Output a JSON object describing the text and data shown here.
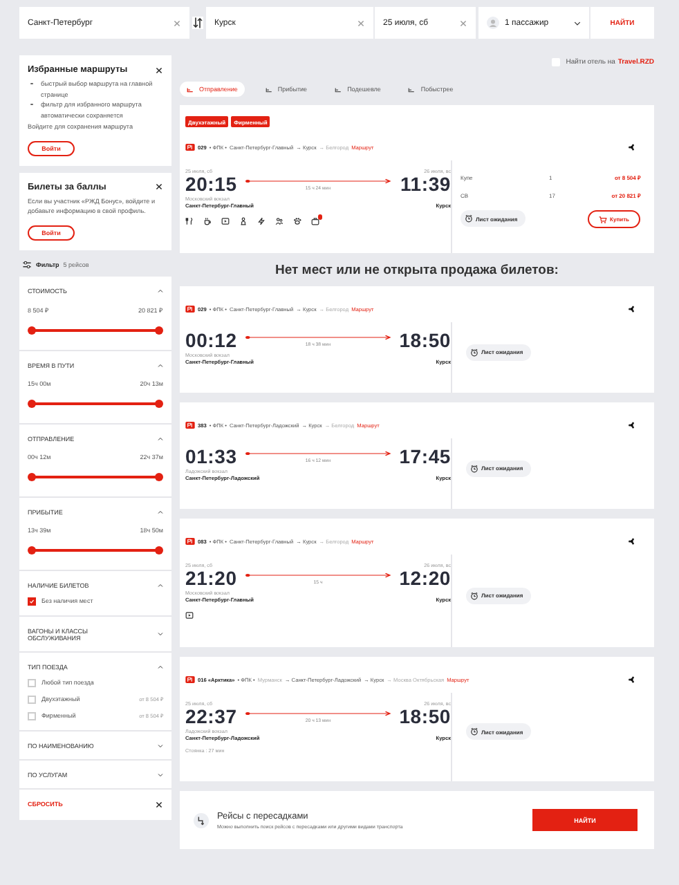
{
  "search": {
    "from": "Санкт-Петербург",
    "to": "Курск",
    "date": "25 июля, сб",
    "passengers": "1 пассажир",
    "button": "НАЙТИ"
  },
  "favorites": {
    "title": "Избранные маршруты",
    "bullets": [
      "быстрый выбор маршрута на главной странице",
      "фильтр для избранного маршрута автоматически сохраняется"
    ],
    "note": "Войдите для сохранения маршрута",
    "button": "Войти"
  },
  "bonus": {
    "title": "Билеты за баллы",
    "text": "Если вы участник «РЖД Бонус», войдите и добавьте информацию в свой профиль.",
    "button": "Войти"
  },
  "filter_header": {
    "label": "Фильтр",
    "count": "5 рейсов"
  },
  "filters": [
    {
      "kind": "range",
      "title": "СТОИМОСТЬ",
      "expanded": true,
      "min": "8 504 ₽",
      "max": "20 821 ₽",
      "level": 1
    },
    {
      "kind": "range",
      "title": "ВРЕМЯ В ПУТИ",
      "expanded": true,
      "min": "15ч 00м",
      "max": "20ч 13м",
      "level": 1
    },
    {
      "kind": "range",
      "title": "ОТПРАВЛЕНИЕ",
      "expanded": true,
      "min": "00ч 12м",
      "max": "22ч 37м",
      "level": 1
    },
    {
      "kind": "range",
      "title": "ПРИБЫТИЕ",
      "expanded": true,
      "min": "13ч 39м",
      "max": "18ч 50м",
      "level": 1
    },
    {
      "kind": "checks",
      "title": "НАЛИЧИЕ БИЛЕТОВ",
      "expanded": true,
      "options": [
        {
          "label": "Без наличия мест",
          "checked": true
        }
      ]
    },
    {
      "title": "ВАГОНЫ И КЛАССЫ ОБСЛУЖИВАНИЯ",
      "expanded": false
    },
    {
      "kind": "checks",
      "title": "ТИП ПОЕЗДА",
      "expanded": true,
      "options": [
        {
          "label": "Любой тип поезда",
          "checked": false
        },
        {
          "label": "Двухэтажный",
          "price": "от 8 504 ₽",
          "checked": false
        },
        {
          "label": "Фирменный",
          "price": "от 8 504 ₽",
          "checked": false
        }
      ]
    },
    {
      "title": "ПО НАИМЕНОВАНИЮ",
      "expanded": false
    },
    {
      "title": "ПО УСЛУГАМ",
      "expanded": false
    }
  ],
  "reset": "СБРОСИТЬ",
  "hotel": {
    "label": "Найти отель на",
    "link": "Travel.RZD",
    "checked": false
  },
  "sort_tabs": [
    {
      "label": "Отправление",
      "selected": true
    },
    {
      "label": "Прибытие",
      "selected": false
    },
    {
      "label": "Подешевле",
      "selected": false
    },
    {
      "label": "Побыстрее",
      "selected": false
    }
  ],
  "trains": [
    {
      "badges": [
        "Двухэтажный",
        "Фирменный"
      ],
      "header": [
        {
          "kind": "number",
          "text": "029"
        },
        {
          "kind": "plain",
          "text": "• ФПК •"
        },
        {
          "kind": "plain",
          "text": "Санкт-Петербург-Главный"
        },
        {
          "kind": "plain",
          "text": "→ Курск"
        },
        {
          "kind": "muted",
          "text": "→ Белгород"
        },
        {
          "kind": "link",
          "text": "Маршрут"
        }
      ],
      "depart": {
        "date": "25 июля, сб",
        "time": "20:15",
        "note": "Московский вокзал",
        "station": "Санкт-Петербург-Главный"
      },
      "arrive": {
        "date": "26 июля, вс",
        "time": "11:39",
        "station": "Курск"
      },
      "duration": "15 ч 24 мин",
      "amenities": [
        {
          "kind": "food"
        },
        {
          "kind": "cup"
        },
        {
          "kind": "video"
        },
        {
          "kind": "person"
        },
        {
          "kind": "bolt"
        },
        {
          "kind": "people"
        },
        {
          "kind": "pet"
        },
        {
          "kind": "bag",
          "badge": true
        }
      ],
      "classes": [
        {
          "name": "Купе",
          "seats": "1",
          "price": "от 8 504 ₽"
        },
        {
          "name": "СВ",
          "seats": "17",
          "price": "от 20 821 ₽"
        }
      ],
      "waitlist": "Лист ожидания",
      "buy": "Купить"
    },
    {
      "heading_before": "Нет мест или не открыта продажа билетов:",
      "header": [
        {
          "kind": "number",
          "text": "029"
        },
        {
          "kind": "plain",
          "text": "• ФПК •"
        },
        {
          "kind": "plain",
          "text": "Санкт-Петербург-Главный"
        },
        {
          "kind": "plain",
          "text": "→ Курск"
        },
        {
          "kind": "muted",
          "text": "→ Белгород"
        },
        {
          "kind": "link",
          "text": "Маршрут"
        }
      ],
      "depart": {
        "time": "00:12",
        "note": "Московский вокзал",
        "station": "Санкт-Петербург-Главный"
      },
      "arrive": {
        "time": "18:50",
        "station": "Курск"
      },
      "duration": "18 ч 38 мин",
      "waitlist": "Лист ожидания"
    },
    {
      "header": [
        {
          "kind": "number",
          "text": "383"
        },
        {
          "kind": "plain",
          "text": "• ФПК •"
        },
        {
          "kind": "plain",
          "text": "Санкт-Петербург-Ладожский"
        },
        {
          "kind": "plain",
          "text": "→ Курск"
        },
        {
          "kind": "muted",
          "text": "→ Белгород"
        },
        {
          "kind": "link",
          "text": "Маршрут"
        }
      ],
      "depart": {
        "time": "01:33",
        "note": "Ладожский вокзал",
        "station": "Санкт-Петербург-Ладожский"
      },
      "arrive": {
        "time": "17:45",
        "station": "Курск"
      },
      "duration": "16 ч 12 мин",
      "waitlist": "Лист ожидания"
    },
    {
      "header": [
        {
          "kind": "number",
          "text": "083"
        },
        {
          "kind": "plain",
          "text": "• ФПК •"
        },
        {
          "kind": "plain",
          "text": "Санкт-Петербург-Главный"
        },
        {
          "kind": "plain",
          "text": "→ Курск"
        },
        {
          "kind": "muted",
          "text": "→ Белгород"
        },
        {
          "kind": "link",
          "text": "Маршрут"
        }
      ],
      "depart": {
        "date": "25 июля, сб",
        "time": "21:20",
        "note": "Московский вокзал",
        "station": "Санкт-Петербург-Главный"
      },
      "arrive": {
        "date": "26 июля, вс",
        "time": "12:20",
        "station": "Курск"
      },
      "duration": "15 ч",
      "amenities": [
        {
          "kind": "video"
        }
      ],
      "waitlist": "Лист ожидания"
    },
    {
      "header": [
        {
          "kind": "number",
          "text": "016 «Арктика»"
        },
        {
          "kind": "plain",
          "text": "• ФПК •"
        },
        {
          "kind": "muted",
          "text": "Мурманск"
        },
        {
          "kind": "plain",
          "text": "→ Санкт-Петербург-Ладожский"
        },
        {
          "kind": "plain",
          "text": "→ Курск"
        },
        {
          "kind": "muted",
          "text": "→ Москва Октябрьская"
        },
        {
          "kind": "link",
          "text": "Маршрут"
        }
      ],
      "depart": {
        "date": "25 июля, сб",
        "time": "22:37",
        "note": "Ладожский вокзал",
        "station": "Санкт-Петербург-Ладожский"
      },
      "arrive": {
        "date": "26 июля, вс",
        "time": "18:50",
        "station": "Курск"
      },
      "duration": "20 ч 13 мин",
      "stop": "Стоянка : 27 мин",
      "waitlist": "Лист ожидания"
    }
  ],
  "transfers": {
    "title": "Рейсы с пересадками",
    "text": "Можно выполнить поиск рейсов с пересадками или другими видами транспорта",
    "button": "НАЙТИ"
  }
}
